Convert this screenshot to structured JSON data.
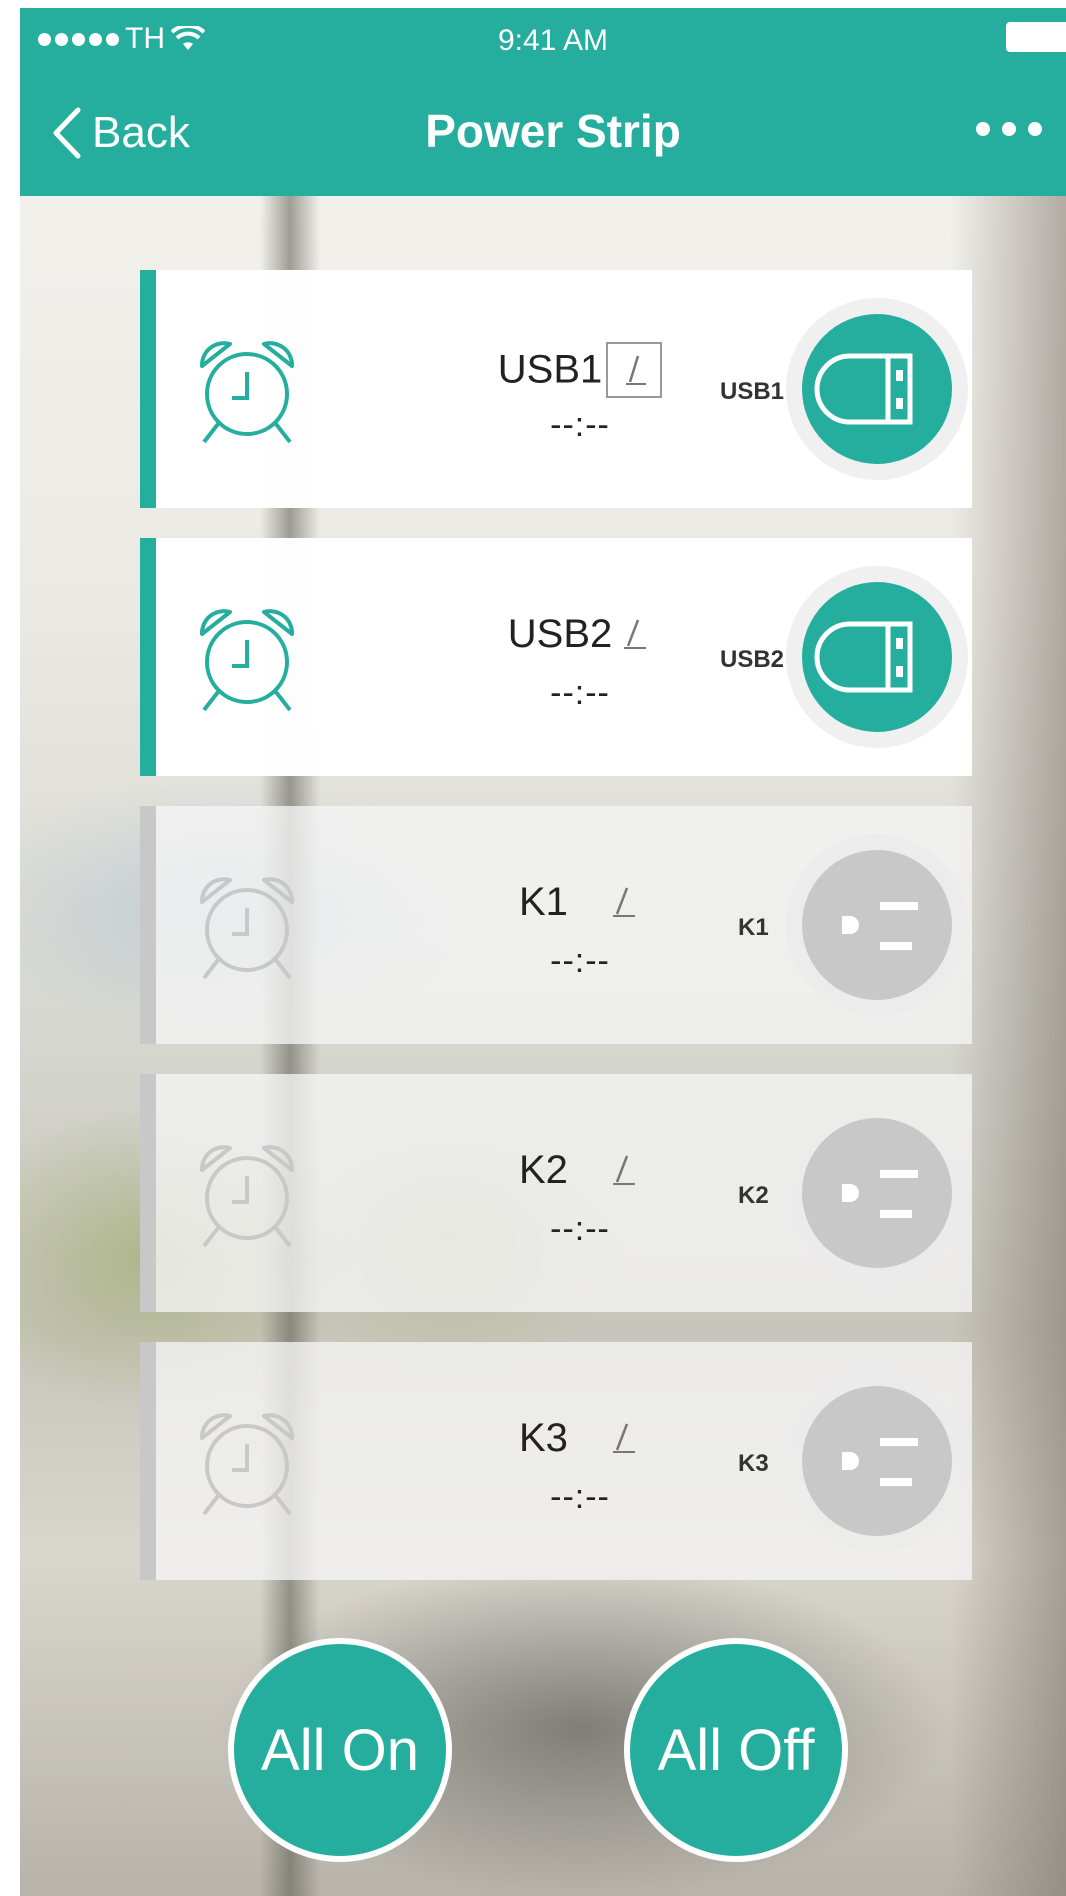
{
  "colors": {
    "accent": "#25ae9e",
    "inactive": "#c8c8c8"
  },
  "status_bar": {
    "carrier": "TH",
    "time": "9:41 AM"
  },
  "nav": {
    "back_label": "Back",
    "title": "Power Strip"
  },
  "outlets": [
    {
      "name": "USB1",
      "time": "--:--",
      "tag": "USB1",
      "state": "on",
      "type": "usb"
    },
    {
      "name": "USB2",
      "time": "--:--",
      "tag": "USB2",
      "state": "on",
      "type": "usb"
    },
    {
      "name": "K1",
      "time": "--:--",
      "tag": "K1",
      "state": "off",
      "type": "plug"
    },
    {
      "name": "K2",
      "time": "--:--",
      "tag": "K2",
      "state": "off",
      "type": "plug"
    },
    {
      "name": "K3",
      "time": "--:--",
      "tag": "K3",
      "state": "off",
      "type": "plug"
    }
  ],
  "actions": {
    "all_on": "All On",
    "all_off": "All Off"
  }
}
